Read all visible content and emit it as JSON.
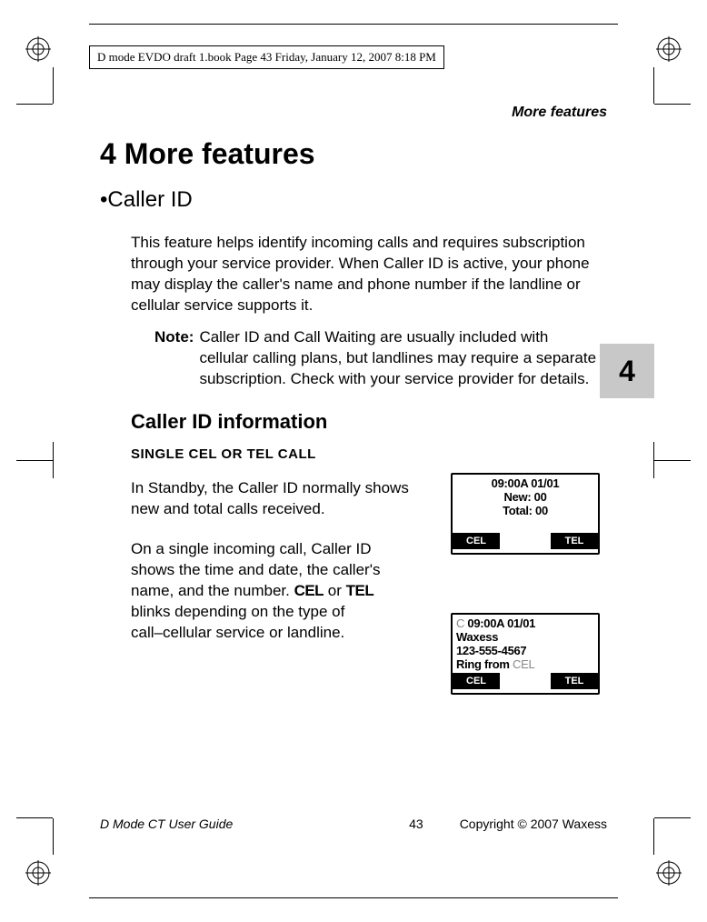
{
  "header_info": "D mode EVDO draft 1.book  Page 43  Friday, January 12, 2007  8:18 PM",
  "running_head": "More features",
  "chapter_title": "4 More features",
  "section_title": "•Caller ID",
  "intro_para": "This feature helps identify incoming calls and requires subscription through your service provider. When Caller ID is active, your phone may display the caller's name and phone number if the landline or cellular service supports it.",
  "note_label": "Note:",
  "note_text": "Caller ID and Call Waiting are usually included with cellular calling plans, but landlines may require a separate subscription. Check with your service provider for details.",
  "chapter_tab": "4",
  "sub_heading": "Caller ID information",
  "sub_sub_heading": "SINGLE CEL OR TEL CALL",
  "para_standby": "In Standby, the Caller ID normally shows new and total calls received.",
  "para_incoming_pre": "On a single incoming call, Caller ID shows the time and date, the caller's name, and the number. ",
  "para_incoming_inline1": "CEL",
  "para_incoming_mid": " or ",
  "para_incoming_inline2": "TEL",
  "para_incoming_post": " blinks depending on the type of",
  "para_incoming_last": "call–cellular service or landline.",
  "screen1": {
    "line1": "09:00A 01/01",
    "line2": "New: 00",
    "line3": "Total: 00",
    "soft_l": "CEL",
    "soft_r": "TEL"
  },
  "screen2": {
    "prefix": "C ",
    "line1": "09:00A 01/01",
    "line2": "Waxess",
    "line3": "123-555-4567",
    "line4a": "Ring from ",
    "line4b": "CEL",
    "soft_l": "CEL",
    "soft_r": "TEL"
  },
  "footer": {
    "guide": "D Mode CT User Guide",
    "page": "43",
    "copyright": "Copyright © 2007 Waxess"
  }
}
